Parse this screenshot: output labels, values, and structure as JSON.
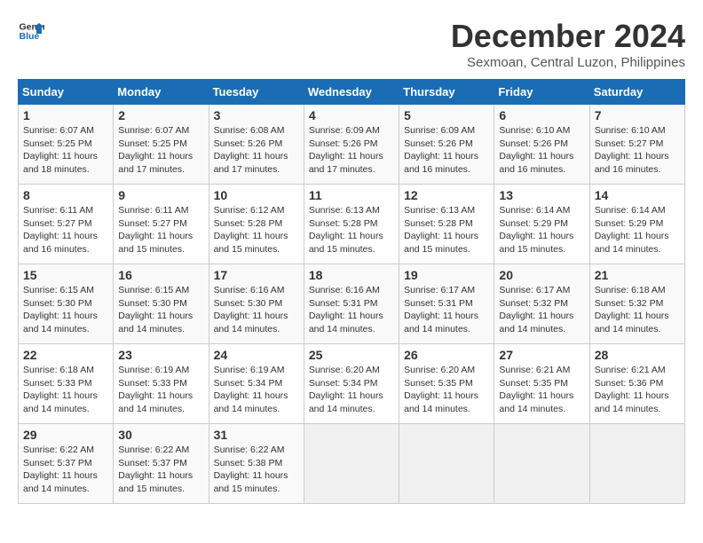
{
  "logo": {
    "line1": "General",
    "line2": "Blue"
  },
  "title": "December 2024",
  "location": "Sexmoan, Central Luzon, Philippines",
  "days_header": [
    "Sunday",
    "Monday",
    "Tuesday",
    "Wednesday",
    "Thursday",
    "Friday",
    "Saturday"
  ],
  "weeks": [
    [
      {
        "day": "1",
        "info": "Sunrise: 6:07 AM\nSunset: 5:25 PM\nDaylight: 11 hours and 18 minutes."
      },
      {
        "day": "2",
        "info": "Sunrise: 6:07 AM\nSunset: 5:25 PM\nDaylight: 11 hours and 17 minutes."
      },
      {
        "day": "3",
        "info": "Sunrise: 6:08 AM\nSunset: 5:26 PM\nDaylight: 11 hours and 17 minutes."
      },
      {
        "day": "4",
        "info": "Sunrise: 6:09 AM\nSunset: 5:26 PM\nDaylight: 11 hours and 17 minutes."
      },
      {
        "day": "5",
        "info": "Sunrise: 6:09 AM\nSunset: 5:26 PM\nDaylight: 11 hours and 16 minutes."
      },
      {
        "day": "6",
        "info": "Sunrise: 6:10 AM\nSunset: 5:26 PM\nDaylight: 11 hours and 16 minutes."
      },
      {
        "day": "7",
        "info": "Sunrise: 6:10 AM\nSunset: 5:27 PM\nDaylight: 11 hours and 16 minutes."
      }
    ],
    [
      {
        "day": "8",
        "info": "Sunrise: 6:11 AM\nSunset: 5:27 PM\nDaylight: 11 hours and 16 minutes."
      },
      {
        "day": "9",
        "info": "Sunrise: 6:11 AM\nSunset: 5:27 PM\nDaylight: 11 hours and 15 minutes."
      },
      {
        "day": "10",
        "info": "Sunrise: 6:12 AM\nSunset: 5:28 PM\nDaylight: 11 hours and 15 minutes."
      },
      {
        "day": "11",
        "info": "Sunrise: 6:13 AM\nSunset: 5:28 PM\nDaylight: 11 hours and 15 minutes."
      },
      {
        "day": "12",
        "info": "Sunrise: 6:13 AM\nSunset: 5:28 PM\nDaylight: 11 hours and 15 minutes."
      },
      {
        "day": "13",
        "info": "Sunrise: 6:14 AM\nSunset: 5:29 PM\nDaylight: 11 hours and 15 minutes."
      },
      {
        "day": "14",
        "info": "Sunrise: 6:14 AM\nSunset: 5:29 PM\nDaylight: 11 hours and 14 minutes."
      }
    ],
    [
      {
        "day": "15",
        "info": "Sunrise: 6:15 AM\nSunset: 5:30 PM\nDaylight: 11 hours and 14 minutes."
      },
      {
        "day": "16",
        "info": "Sunrise: 6:15 AM\nSunset: 5:30 PM\nDaylight: 11 hours and 14 minutes."
      },
      {
        "day": "17",
        "info": "Sunrise: 6:16 AM\nSunset: 5:30 PM\nDaylight: 11 hours and 14 minutes."
      },
      {
        "day": "18",
        "info": "Sunrise: 6:16 AM\nSunset: 5:31 PM\nDaylight: 11 hours and 14 minutes."
      },
      {
        "day": "19",
        "info": "Sunrise: 6:17 AM\nSunset: 5:31 PM\nDaylight: 11 hours and 14 minutes."
      },
      {
        "day": "20",
        "info": "Sunrise: 6:17 AM\nSunset: 5:32 PM\nDaylight: 11 hours and 14 minutes."
      },
      {
        "day": "21",
        "info": "Sunrise: 6:18 AM\nSunset: 5:32 PM\nDaylight: 11 hours and 14 minutes."
      }
    ],
    [
      {
        "day": "22",
        "info": "Sunrise: 6:18 AM\nSunset: 5:33 PM\nDaylight: 11 hours and 14 minutes."
      },
      {
        "day": "23",
        "info": "Sunrise: 6:19 AM\nSunset: 5:33 PM\nDaylight: 11 hours and 14 minutes."
      },
      {
        "day": "24",
        "info": "Sunrise: 6:19 AM\nSunset: 5:34 PM\nDaylight: 11 hours and 14 minutes."
      },
      {
        "day": "25",
        "info": "Sunrise: 6:20 AM\nSunset: 5:34 PM\nDaylight: 11 hours and 14 minutes."
      },
      {
        "day": "26",
        "info": "Sunrise: 6:20 AM\nSunset: 5:35 PM\nDaylight: 11 hours and 14 minutes."
      },
      {
        "day": "27",
        "info": "Sunrise: 6:21 AM\nSunset: 5:35 PM\nDaylight: 11 hours and 14 minutes."
      },
      {
        "day": "28",
        "info": "Sunrise: 6:21 AM\nSunset: 5:36 PM\nDaylight: 11 hours and 14 minutes."
      }
    ],
    [
      {
        "day": "29",
        "info": "Sunrise: 6:22 AM\nSunset: 5:37 PM\nDaylight: 11 hours and 14 minutes."
      },
      {
        "day": "30",
        "info": "Sunrise: 6:22 AM\nSunset: 5:37 PM\nDaylight: 11 hours and 15 minutes."
      },
      {
        "day": "31",
        "info": "Sunrise: 6:22 AM\nSunset: 5:38 PM\nDaylight: 11 hours and 15 minutes."
      },
      {
        "day": "",
        "info": ""
      },
      {
        "day": "",
        "info": ""
      },
      {
        "day": "",
        "info": ""
      },
      {
        "day": "",
        "info": ""
      }
    ]
  ]
}
